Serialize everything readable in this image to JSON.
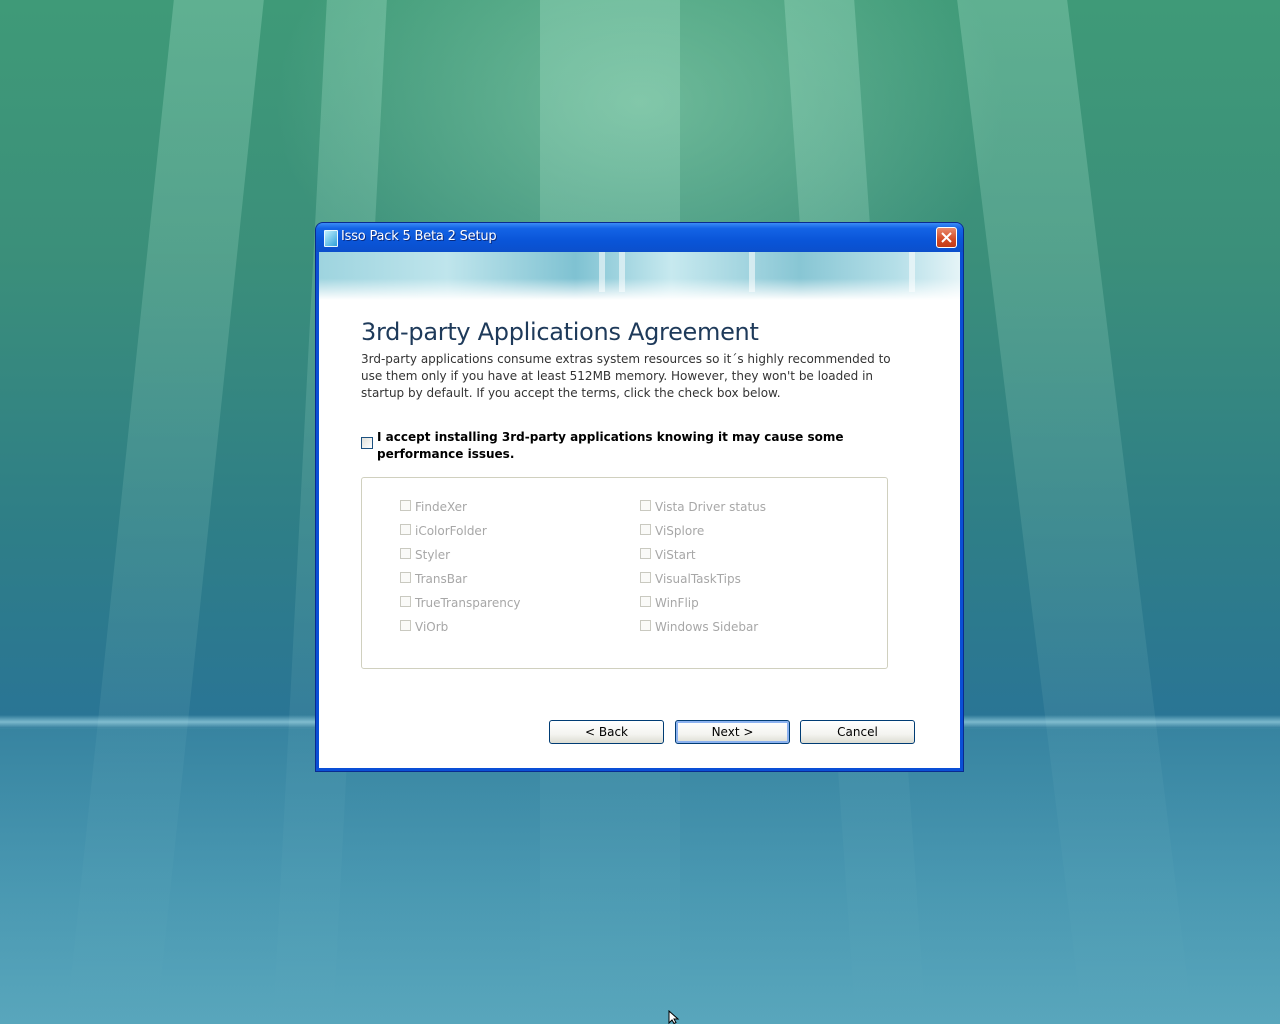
{
  "window": {
    "title": "Isso Pack 5 Beta 2 Setup"
  },
  "page": {
    "heading": "3rd-party Applications Agreement",
    "description": "3rd-party applications consume extras system resources so it´s highly recommended to use them only if you have at least 512MB memory. However, they won't be loaded in startup by default. If you accept the terms, click the check box below.",
    "accept_label": "I accept installing 3rd-party applications knowing it may cause some performance issues.",
    "accept_checked": false
  },
  "options": {
    "left": [
      "FindeXer",
      "iColorFolder",
      "Styler",
      "TransBar",
      "TrueTransparency",
      "ViOrb"
    ],
    "right": [
      "Vista Driver status",
      "ViSplore",
      "ViStart",
      "VisualTaskTips",
      "WinFlip",
      "Windows Sidebar"
    ]
  },
  "buttons": {
    "back": "< Back",
    "next": "Next >",
    "cancel": "Cancel"
  }
}
